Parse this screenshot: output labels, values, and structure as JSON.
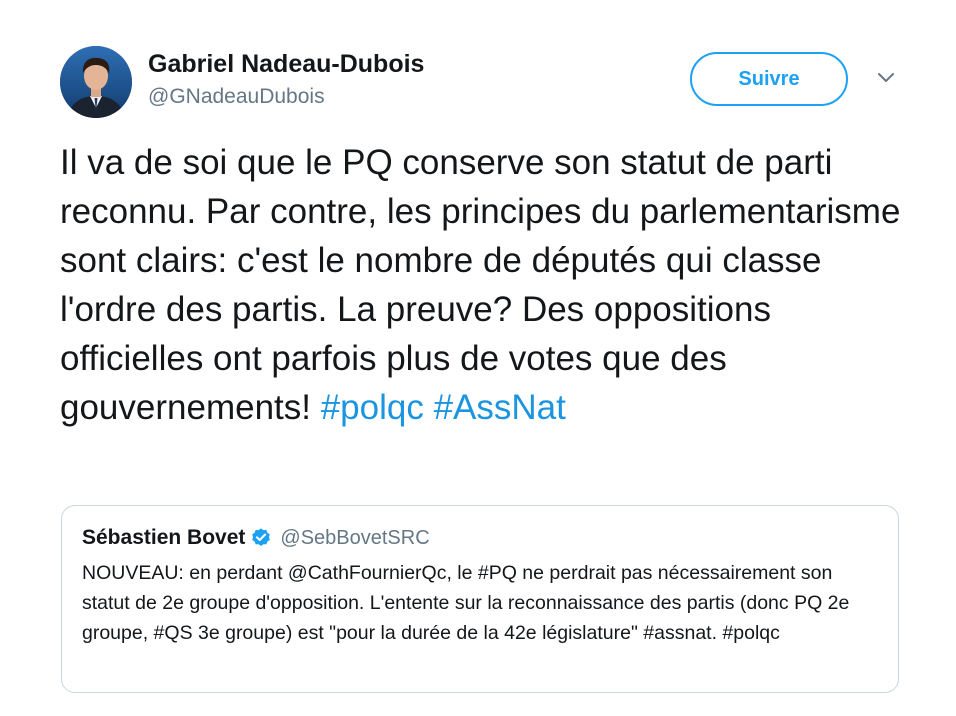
{
  "tweet": {
    "author": {
      "name": "Gabriel Nadeau-Dubois",
      "handle": "@GNadeauDubois",
      "avatar_icon": "profile-photo"
    },
    "follow_button_label": "Suivre",
    "menu_icon": "chevron-down-icon",
    "text": "Il va de soi que le PQ conserve son statut de parti reconnu. Par contre, les principes du parlementarisme sont clairs: c'est le nombre de députés qui classe l'ordre des partis. La preuve? Des oppositions officielles ont parfois plus de votes que des gouvernements!",
    "hashtags": [
      "#polqc",
      "#AssNat"
    ]
  },
  "quoted_tweet": {
    "author_name": "Sébastien Bovet",
    "verified_icon": "verified-badge-icon",
    "author_handle": "@SebBovetSRC",
    "text": "NOUVEAU: en perdant @CathFournierQc, le #PQ ne perdrait pas nécessairement son statut de 2e groupe d'opposition. L'entente sur la reconnaissance des partis (donc PQ 2e groupe, #QS 3e groupe) est \"pour la durée de la 42e législature\" #assnat. #polqc"
  },
  "colors": {
    "link_blue": "#1b95e0",
    "button_blue": "#1da1f2",
    "secondary_text": "#657786",
    "primary_text": "#14171a",
    "border": "#ccd6dd"
  }
}
